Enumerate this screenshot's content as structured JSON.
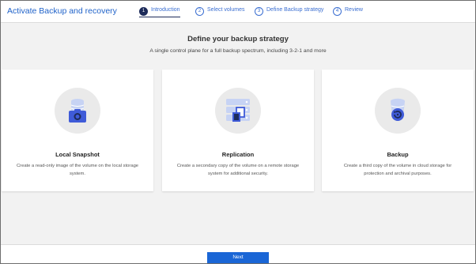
{
  "header": {
    "app_title": "Activate Backup and recovery"
  },
  "wizard": {
    "steps": [
      {
        "number": "1",
        "label": "Introduction",
        "active": true
      },
      {
        "number": "2",
        "label": "Select volumes",
        "active": false
      },
      {
        "number": "3",
        "label": "Define Backup strategy",
        "active": false
      },
      {
        "number": "4",
        "label": "Review",
        "active": false
      }
    ]
  },
  "main": {
    "title": "Define your backup strategy",
    "subtitle": "A single control plane for a full backup spectrum, including 3-2-1 and more",
    "cards": [
      {
        "icon": "camera-database-icon",
        "title": "Local Snapshot",
        "description": "Create a read-only image of the volume on the local storage system."
      },
      {
        "icon": "replication-icon",
        "title": "Replication",
        "description": "Create a secondary copy of the volume on a remote storage system for additional security."
      },
      {
        "icon": "cloud-backup-icon",
        "title": "Backup",
        "description": "Create a third copy of the volume in cloud storage for protection and archival purposes."
      }
    ]
  },
  "footer": {
    "next_label": "Next"
  },
  "colors": {
    "accent": "#1a66d6",
    "active_step": "#1d2b5a",
    "link": "#3a6ed1",
    "icon_light": "#c7d3f4",
    "icon_dark": "#3f5bd8"
  }
}
